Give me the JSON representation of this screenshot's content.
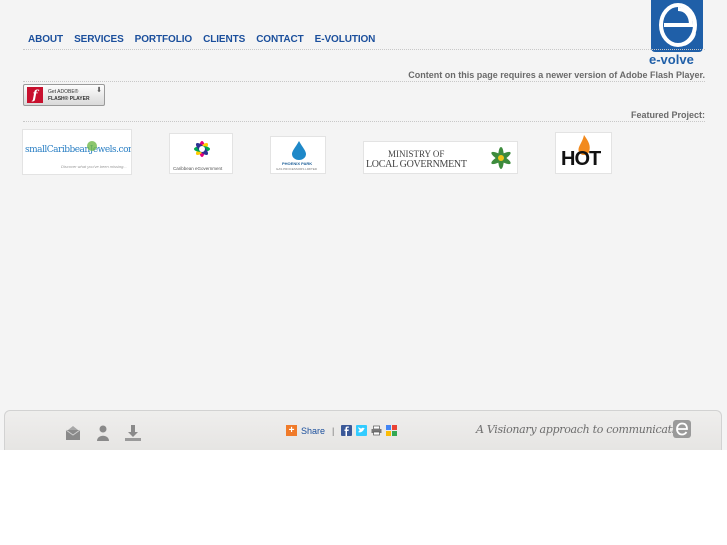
{
  "nav": {
    "items": [
      {
        "label": "ABOUT"
      },
      {
        "label": "SERVICES"
      },
      {
        "label": "PORTFOLIO"
      },
      {
        "label": "CLIENTS"
      },
      {
        "label": "CONTACT"
      },
      {
        "label": "E-VOLUTION"
      }
    ]
  },
  "logo": {
    "text": "e-volve",
    "color": "#1f5fa8"
  },
  "flash": {
    "message": "Content on this page requires a newer version of Adobe Flash Player.",
    "badge_line1": "Get ADOBE®",
    "badge_line2": "FLASH® PLAYER"
  },
  "featured": {
    "label": "Featured Project:"
  },
  "clients": [
    {
      "name": "smallCaribbeanJewels.com",
      "tagline": "Discover what you've been missing..."
    },
    {
      "name": "Caribbean eGovernment"
    },
    {
      "name": "PHOENIX PARK",
      "tagline": "GAS PROCESSORS LIMITED"
    },
    {
      "name_line1": "MINISTRY OF",
      "name_line2": "LOCAL GOVERNMENT"
    },
    {
      "name": "HOT"
    }
  ],
  "footer": {
    "share_label": "Share",
    "separator": "|",
    "tagline": "A Visionary approach to communication",
    "icons": [
      "mail-icon",
      "person-icon",
      "download-icon"
    ],
    "share_icons": [
      "facebook-icon",
      "twitter-icon",
      "print-icon",
      "bookmark-icon"
    ]
  },
  "colors": {
    "nav": "#1b4f9c",
    "accent": "#1f5fa8",
    "background": "#f4f4f4"
  }
}
